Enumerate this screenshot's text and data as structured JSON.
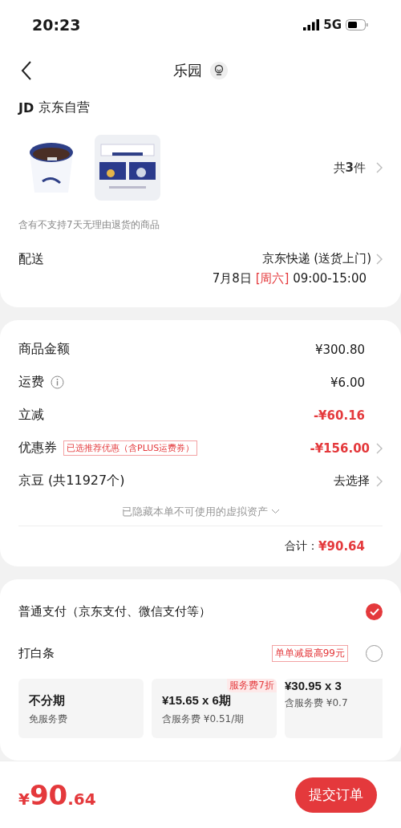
{
  "status_bar": {
    "time": "20:23",
    "network": "5G"
  },
  "nav": {
    "title": "乐园"
  },
  "store": {
    "logo": "JD",
    "name": "京东自营"
  },
  "products": {
    "count": "共**3**件"
  },
  "return_note": "含有不支持7天无理由退货的商品",
  "delivery": {
    "label": "配送",
    "method": "京东快递 (送货上门)",
    "date": "7月8日",
    "weekday": "[周六]",
    "time": "09:00-15:00"
  },
  "summary": {
    "rows": [
      {
        "label": "商品金额",
        "value": "¥300.80",
        "negative": false,
        "info": false,
        "arrow": false
      },
      {
        "label": "运费",
        "value": "¥6.00",
        "negative": false,
        "info": true,
        "arrow": false
      },
      {
        "label": "立减",
        "value": "-¥60.16",
        "negative": true,
        "info": false,
        "arrow": false
      },
      {
        "label": "优惠券",
        "tag": "已选推荐优惠（含PLUS运费券）",
        "value": "-¥156.00",
        "negative": true,
        "info": false,
        "arrow": true
      },
      {
        "label": "京豆 (共11927个)",
        "value": "去选择",
        "negative": false,
        "info": false,
        "arrow": true
      }
    ],
    "hidden_note": "已隐藏本单不可使用的虚拟资产",
    "total_label": "合计：",
    "total": "¥90.64"
  },
  "payment": {
    "options": [
      {
        "label": "普通支付（京东支付、微信支付等）",
        "selected": true
      },
      {
        "label": "打白条",
        "tag": "单单减最高99元",
        "selected": false
      }
    ],
    "installments": [
      {
        "title": "不分期",
        "subtitle": "免服务费"
      },
      {
        "title": "¥15.65 x 6期",
        "subtitle": "含服务费 ¥0.51/期",
        "badge": "服务费7折"
      },
      {
        "title": "¥30.95 x 3",
        "subtitle": "含服务费 ¥0.7"
      }
    ]
  },
  "footer": {
    "currency": "¥",
    "price": "90",
    "decimals": ".64",
    "submit": "提交订单"
  }
}
